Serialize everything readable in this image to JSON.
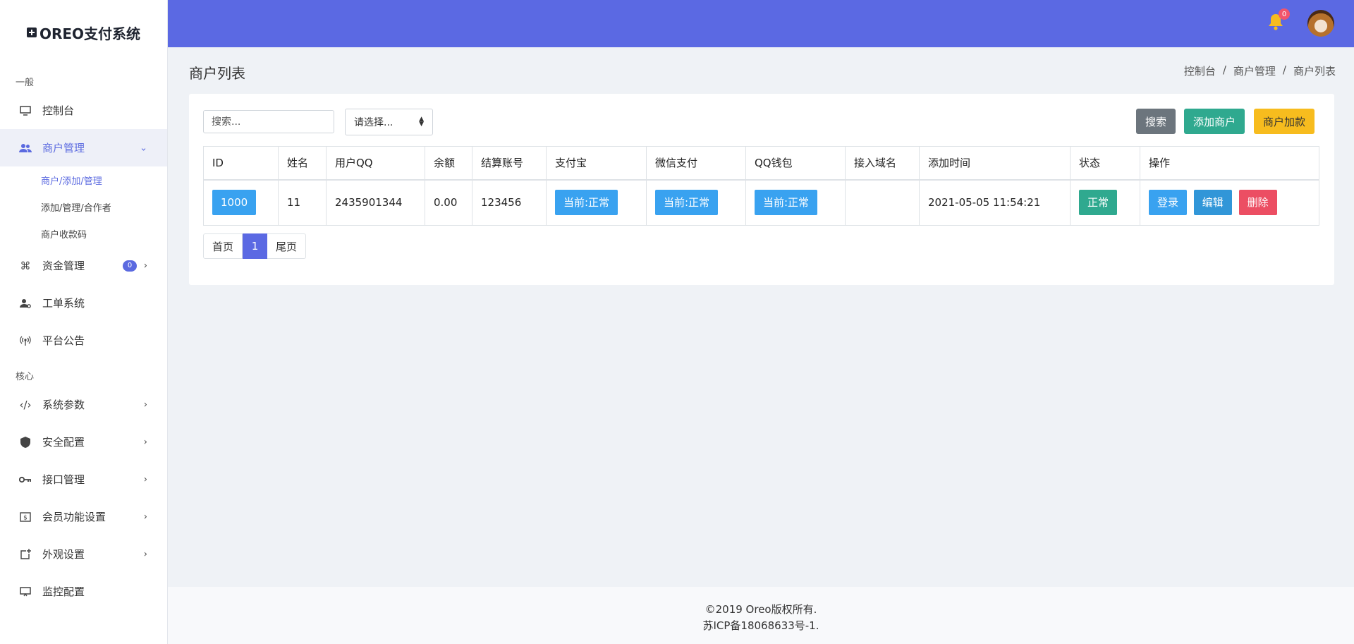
{
  "brand": {
    "name": "OREO支付系统"
  },
  "sidebar": {
    "section_general": "一般",
    "section_core": "核心",
    "items": [
      {
        "label": "控制台",
        "icon": "monitor-icon"
      },
      {
        "label": "商户管理",
        "icon": "users-icon",
        "active": true
      },
      {
        "label": "资金管理",
        "icon": "command-icon",
        "badge": "0"
      },
      {
        "label": "工单系统",
        "icon": "user-gear-icon"
      },
      {
        "label": "平台公告",
        "icon": "broadcast-icon"
      },
      {
        "label": "系统参数",
        "icon": "code-icon"
      },
      {
        "label": "安全配置",
        "icon": "shield-icon"
      },
      {
        "label": "接口管理",
        "icon": "key-icon"
      },
      {
        "label": "会员功能设置",
        "icon": "dollar-box-icon"
      },
      {
        "label": "外观设置",
        "icon": "add-box-icon"
      },
      {
        "label": "监控配置",
        "icon": "display-icon"
      }
    ],
    "subitems": [
      "商户/添加/管理",
      "添加/管理/合作者",
      "商户收款码"
    ]
  },
  "topbar": {
    "notification_count": "0"
  },
  "page": {
    "title": "商户列表",
    "breadcrumb": [
      "控制台",
      "商户管理",
      "商户列表"
    ]
  },
  "toolbar": {
    "search_placeholder": "搜索...",
    "select_value": "请选择...",
    "search_label": "搜索",
    "add_label": "添加商户",
    "credit_label": "商户加款"
  },
  "table": {
    "headers": [
      "ID",
      "姓名",
      "用户QQ",
      "余额",
      "结算账号",
      "支付宝",
      "微信支付",
      "QQ钱包",
      "接入域名",
      "添加时间",
      "状态",
      "操作"
    ],
    "rows": [
      {
        "id": "1000",
        "name": "11",
        "qq": "2435901344",
        "balance": "0.00",
        "account": "123456",
        "alipay": "当前:正常",
        "wechat": "当前:正常",
        "qqwallet": "当前:正常",
        "domain": "",
        "added": "2021-05-05 11:54:21",
        "status": "正常",
        "actions": {
          "login": "登录",
          "edit": "编辑",
          "delete": "删除"
        }
      }
    ]
  },
  "pager": {
    "first": "首页",
    "current": "1",
    "last": "尾页"
  },
  "footer": {
    "line1": "©2019 Oreo版权所有.",
    "line2": "苏ICP备18068633号-1."
  },
  "colors": {
    "accent": "#5b69e3",
    "success": "#2fa98f",
    "info": "#39a2f0",
    "danger": "#ec4e63",
    "warning": "#f7bc1e"
  }
}
